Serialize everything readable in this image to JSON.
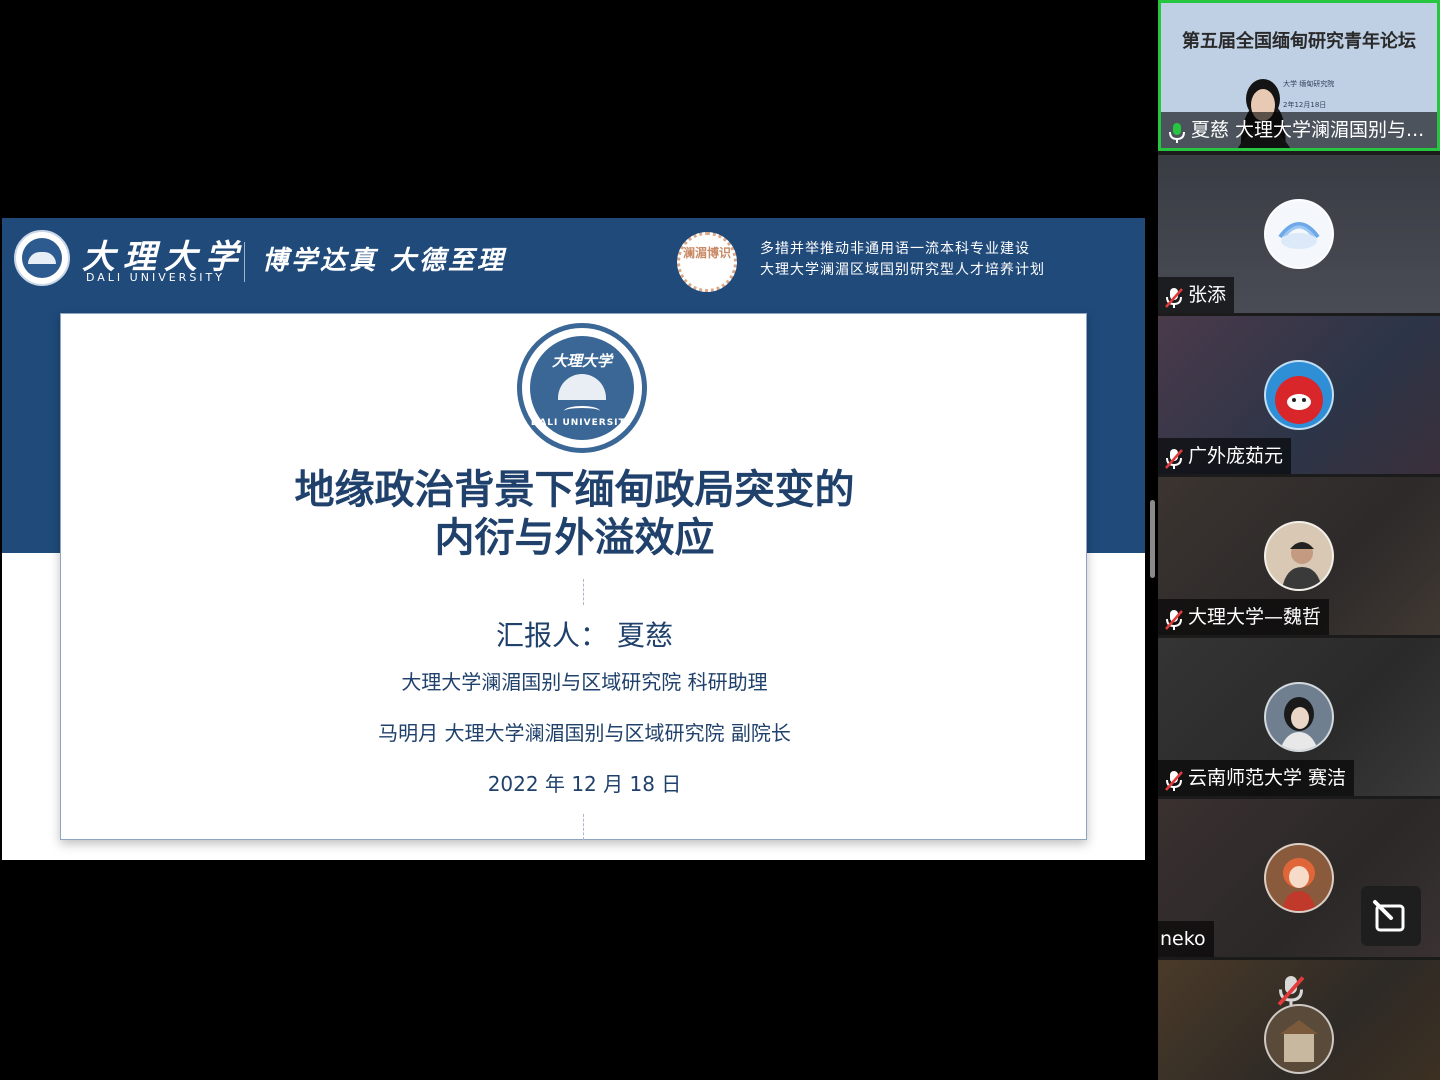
{
  "slide": {
    "university_name_cn": "大理大学",
    "university_name_en": "DALI UNIVERSITY",
    "motto": "博学达真 大德至理",
    "badge_text": "澜湄博识",
    "program_line1": "多措并举推动非通用语一流本科专业建设",
    "program_line2": "大理大学澜湄区域国别研究型人才培养计划",
    "seal_text_cn": "大理大学",
    "seal_text_en": "DALI UNIVERSITY",
    "title_line1": "地缘政治背景下缅甸政局突变的",
    "title_line2": "内衍与外溢效应",
    "presenter": "汇报人：  夏慈",
    "presenter_affiliation": "大理大学澜湄国别与区域研究院 科研助理",
    "coauthor": "马明月  大理大学澜湄国别与区域研究院 副院长",
    "date": "2022 年 12 月 18 日"
  },
  "participants": [
    {
      "name": "夏慈  大理大学澜湄国别与...",
      "mic": "on",
      "video": "on",
      "active_speaker": true,
      "preview_title": "第五届全国缅甸研究青年论坛",
      "preview_small1": "大学 缅甸研究院",
      "preview_small2": "2年12月18日"
    },
    {
      "name": "张添",
      "mic": "muted",
      "avatar": "cloud-rainbow-avatar"
    },
    {
      "name": "广外庞茹元",
      "mic": "muted",
      "avatar": "red-mascot-avatar"
    },
    {
      "name": "大理大学—魏哲",
      "mic": "muted",
      "avatar": "person-hat-avatar"
    },
    {
      "name": "云南师范大学 赛洁",
      "mic": "muted",
      "avatar": "person-dark-hair-avatar"
    },
    {
      "name": "neko",
      "mic": "none",
      "avatar": "anime-girl-avatar"
    },
    {
      "name": "",
      "mic": "muted",
      "avatar": "building-avatar"
    }
  ],
  "colors": {
    "slide_band": "#1f4a7a",
    "title_text": "#20416b",
    "active_border": "#26c640",
    "mute_red": "#e23b3b"
  }
}
